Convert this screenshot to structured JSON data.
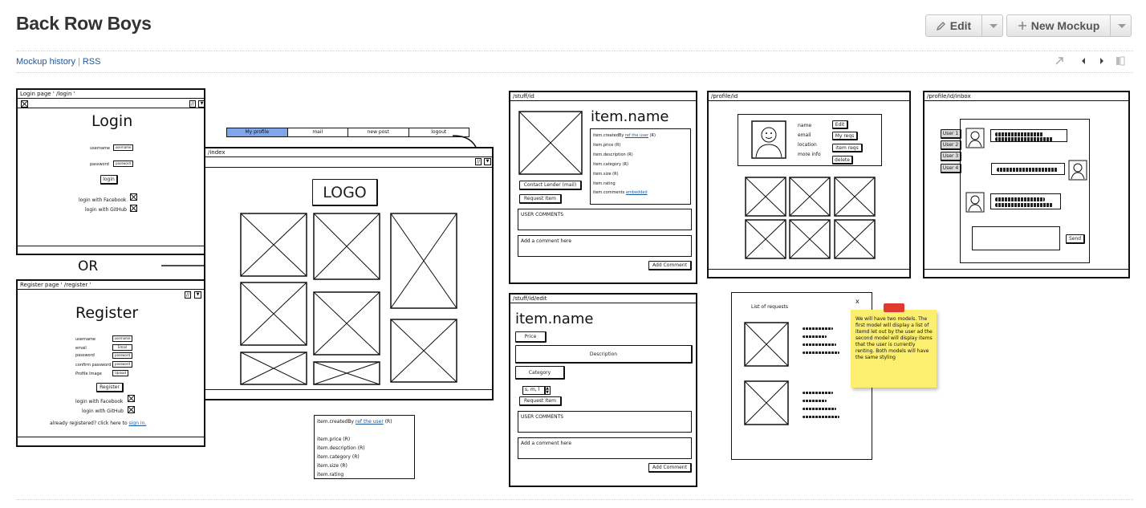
{
  "page": {
    "title": "Back Row Boys",
    "edit_label": "Edit",
    "new_mockup_label": "New Mockup",
    "links": {
      "history": "Mockup history",
      "separator": "|",
      "rss": "RSS"
    }
  },
  "mockups": {
    "login": {
      "bar": "Login page ' /login '",
      "heading": "Login",
      "username_label": "username",
      "username_value": "username",
      "password_label": "password",
      "password_value": "password",
      "login_btn": "login",
      "facebook": "login with Facebook",
      "github": "login with GitHub",
      "nav": "//"
    },
    "or_text": "OR",
    "register": {
      "bar": "Register page ' /register '",
      "heading": "Register",
      "username_label": "username",
      "username_value": "username",
      "email_label": "email",
      "email_value": "Email",
      "password_label": "password",
      "password_value": "password",
      "confirm_label": "confirm password",
      "confirm_value": "password",
      "image_label": "Profile Image",
      "image_value": "Upload",
      "register_btn": "Register",
      "facebook": "login with Facebook",
      "github": "login with GitHub",
      "already": "already registered? click here to",
      "signin": "sign in.",
      "nav": "//"
    },
    "index": {
      "tabs": [
        "My profile",
        "mail",
        "new post",
        "logout"
      ],
      "bar": "/index",
      "logo": "LOGO",
      "nav": "//"
    },
    "item_fields": {
      "created_by": "item.createdBy",
      "ref_user": "ref the user",
      "ref_suffix": "(R)",
      "lines": [
        "item.price (R)",
        "item.description (R)",
        "item.category (R)",
        "item.size (R)",
        "item.rating"
      ]
    },
    "stuff": {
      "bar": "/stuff/id",
      "heading": "item.name",
      "created_by": "item.createdBy",
      "ref_user": "ref the user",
      "ref_suffix": "(R)",
      "fields": [
        "item.price (R)",
        "item.description (R)",
        "item.category (R)",
        "item.size (R)",
        "item.rating"
      ],
      "comments_field": "item.comments",
      "embedded": "embedded",
      "contact_btn": "Contact Lender (mail)",
      "request_btn": "Request Item",
      "user_comments": "USER COMMENTS",
      "add_placeholder": "Add a comment here",
      "add_btn": "Add Comment"
    },
    "stuff_edit": {
      "bar": "/stuff/id/edit",
      "heading": "item.name",
      "price": "Price",
      "description": "Description",
      "category": "Category",
      "size_value": "s, m, l",
      "request_btn": "Request Item",
      "user_comments": "USER COMMENTS",
      "add_placeholder": "Add a comment here",
      "add_btn": "Add Comment"
    },
    "profile": {
      "bar": "/profile/id",
      "labels": [
        "name",
        "email",
        "location",
        "more info"
      ],
      "buttons": [
        "Edit",
        "My reqs",
        "item reqs",
        "delete"
      ]
    },
    "requests": {
      "title": "List of requests",
      "close": "x",
      "note": "We will have two models. The first model will display a list of itemd let out by the user ad the second model will display items that the user is currently renting. Both models will have the same styling"
    },
    "inbox": {
      "bar": "/profile/id/inbox",
      "users": [
        "User 1",
        "User 2",
        "User 3",
        "User 4"
      ],
      "send_btn": "Send"
    }
  }
}
